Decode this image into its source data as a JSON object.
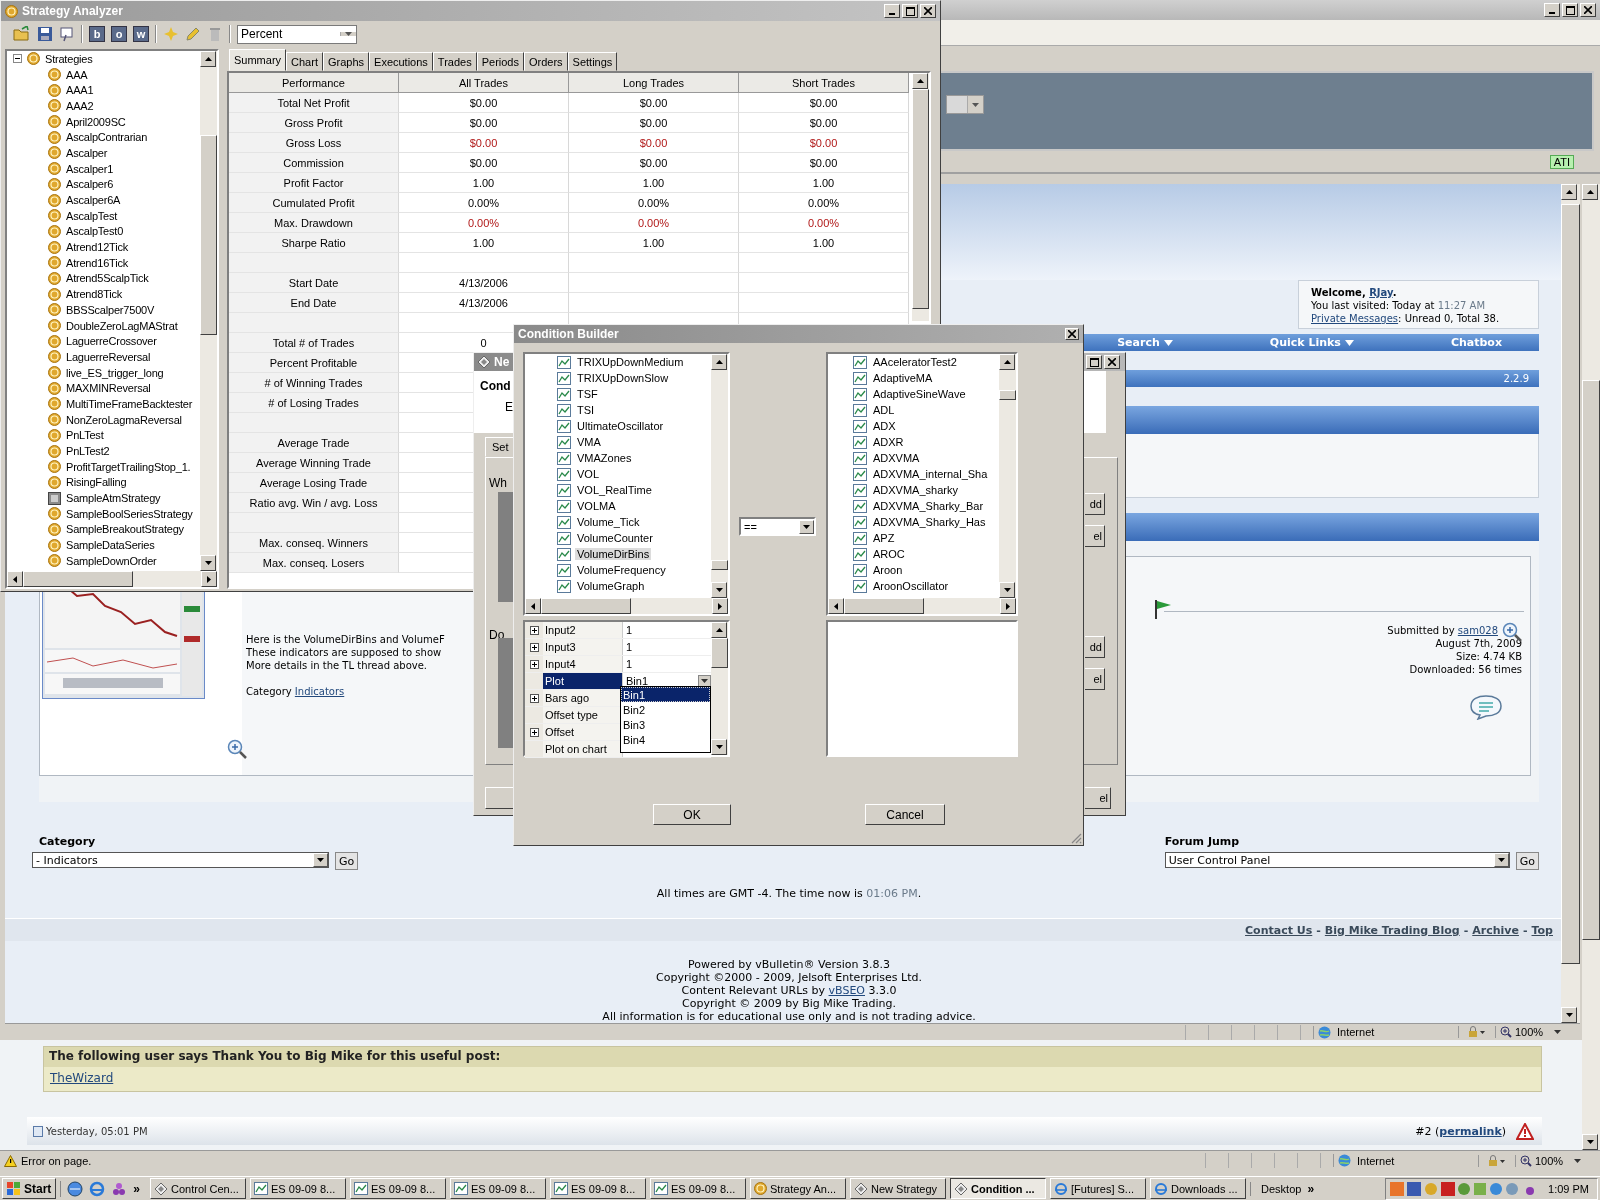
{
  "control_window": {
    "ati_badge": "ATI"
  },
  "strategy_analyzer": {
    "title": "Strategy Analyzer",
    "toolbar_letters": [
      "b",
      "o",
      "w"
    ],
    "dropdown": "Percent",
    "tree": {
      "root": "Strategies",
      "expanded": true,
      "items": [
        {
          "label": "AAA",
          "kind": "coin"
        },
        {
          "label": "AAA1",
          "kind": "coin"
        },
        {
          "label": "AAA2",
          "kind": "coin"
        },
        {
          "label": "April2009SC",
          "kind": "coin"
        },
        {
          "label": "AscalpContrarian",
          "kind": "coin"
        },
        {
          "label": "Ascalper",
          "kind": "coin"
        },
        {
          "label": "Ascalper1",
          "kind": "coin"
        },
        {
          "label": "Ascalper6",
          "kind": "coin"
        },
        {
          "label": "Ascalper6A",
          "kind": "coin"
        },
        {
          "label": "AscalpTest",
          "kind": "coin"
        },
        {
          "label": "AscalpTest0",
          "kind": "coin"
        },
        {
          "label": "Atrend12Tick",
          "kind": "coin"
        },
        {
          "label": "Atrend16Tick",
          "kind": "coin"
        },
        {
          "label": "Atrend5ScalpTick",
          "kind": "coin"
        },
        {
          "label": "Atrend8Tick",
          "kind": "coin"
        },
        {
          "label": "BBSScalper7500V",
          "kind": "coin"
        },
        {
          "label": "DoubleZeroLagMAStrat",
          "kind": "coin"
        },
        {
          "label": "LaguerreCrossover",
          "kind": "coin"
        },
        {
          "label": "LaguerreReversal",
          "kind": "coin"
        },
        {
          "label": "live_ES_trigger_long",
          "kind": "coin"
        },
        {
          "label": "MAXMINReversal",
          "kind": "coin"
        },
        {
          "label": "MultiTimeFrameBacktester",
          "kind": "coin"
        },
        {
          "label": "NonZeroLagmaReversal",
          "kind": "coin"
        },
        {
          "label": "PnLTest",
          "kind": "coin"
        },
        {
          "label": "PnLTest2",
          "kind": "coin"
        },
        {
          "label": "ProfitTargetTrailingStop_1.",
          "kind": "coin"
        },
        {
          "label": "RisingFalling",
          "kind": "coin"
        },
        {
          "label": "SampleAtmStrategy",
          "kind": "atm"
        },
        {
          "label": "SampleBoolSeriesStrategy",
          "kind": "coin"
        },
        {
          "label": "SampleBreakoutStrategy",
          "kind": "coin"
        },
        {
          "label": "SampleDataSeries",
          "kind": "coin"
        },
        {
          "label": "SampleDownOrder",
          "kind": "coin"
        }
      ]
    },
    "tabs": [
      {
        "label": "Summary",
        "selected": true
      },
      {
        "label": "Chart",
        "selected": false
      },
      {
        "label": "Graphs",
        "selected": false
      },
      {
        "label": "Executions",
        "selected": false
      },
      {
        "label": "Trades",
        "selected": false
      },
      {
        "label": "Periods",
        "selected": false
      },
      {
        "label": "Orders",
        "selected": false
      },
      {
        "label": "Settings",
        "selected": false
      }
    ],
    "table": {
      "columns": [
        "Performance",
        "All Trades",
        "Long Trades",
        "Short Trades"
      ],
      "rows": [
        {
          "kind": "data",
          "cells": [
            "Total Net Profit",
            "$0.00",
            "$0.00",
            "$0.00"
          ],
          "negative": false
        },
        {
          "kind": "data",
          "cells": [
            "Gross Profit",
            "$0.00",
            "$0.00",
            "$0.00"
          ],
          "negative": false
        },
        {
          "kind": "data",
          "cells": [
            "Gross Loss",
            "$0.00",
            "$0.00",
            "$0.00"
          ],
          "negative": true
        },
        {
          "kind": "data",
          "cells": [
            "Commission",
            "$0.00",
            "$0.00",
            "$0.00"
          ],
          "negative": false
        },
        {
          "kind": "data",
          "cells": [
            "Profit Factor",
            "1.00",
            "1.00",
            "1.00"
          ],
          "negative": false
        },
        {
          "kind": "data",
          "cells": [
            "Cumulated Profit",
            "0.00%",
            "0.00%",
            "0.00%"
          ],
          "negative": false
        },
        {
          "kind": "data",
          "cells": [
            "Max. Drawdown",
            "0.00%",
            "0.00%",
            "0.00%"
          ],
          "negative": true
        },
        {
          "kind": "data",
          "cells": [
            "Sharpe Ratio",
            "1.00",
            "1.00",
            "1.00"
          ],
          "negative": false
        },
        {
          "kind": "spacer"
        },
        {
          "kind": "data",
          "cells": [
            "Start Date",
            "4/13/2006"
          ],
          "negative": false
        },
        {
          "kind": "data",
          "cells": [
            "End Date",
            "4/13/2006"
          ],
          "negative": false
        },
        {
          "kind": "spacer"
        },
        {
          "kind": "data",
          "cells": [
            "Total # of Trades",
            "0"
          ],
          "negative": false
        },
        {
          "kind": "data",
          "cells": [
            "Percent Profitable"
          ]
        },
        {
          "kind": "data",
          "cells": [
            "# of Winning Trades"
          ]
        },
        {
          "kind": "data",
          "cells": [
            "# of Losing Trades"
          ]
        },
        {
          "kind": "spacer"
        },
        {
          "kind": "data",
          "cells": [
            "Average Trade"
          ]
        },
        {
          "kind": "data",
          "cells": [
            "Average Winning Trade"
          ]
        },
        {
          "kind": "data",
          "cells": [
            "Average Losing Trade"
          ]
        },
        {
          "kind": "data",
          "cells": [
            "Ratio avg. Win / avg. Loss"
          ]
        },
        {
          "kind": "spacer"
        },
        {
          "kind": "data",
          "cells": [
            "Max. conseq. Winners"
          ]
        },
        {
          "kind": "data",
          "cells": [
            "Max. conseq. Losers"
          ]
        }
      ]
    }
  },
  "new_strategy": {
    "title": "Ne",
    "heading": "Cond",
    "line": "E",
    "tab": "Set",
    "label_1": "Wh",
    "label_2": "Do",
    "side_buttons": [
      "dd",
      "el",
      "dd",
      "el",
      "el"
    ]
  },
  "condition_builder": {
    "title": "Condition Builder",
    "left_list": [
      {
        "label": "TRIXUpDownMedium",
        "selected": false
      },
      {
        "label": "TRIXUpDownSlow",
        "selected": false
      },
      {
        "label": "TSF",
        "selected": false
      },
      {
        "label": "TSI",
        "selected": false
      },
      {
        "label": "UltimateOscillator",
        "selected": false
      },
      {
        "label": "VMA",
        "selected": false
      },
      {
        "label": "VMAZones",
        "selected": false
      },
      {
        "label": "VOL",
        "selected": false
      },
      {
        "label": "VOL_RealTime",
        "selected": false
      },
      {
        "label": "VOLMA",
        "selected": false
      },
      {
        "label": "Volume_Tick",
        "selected": false
      },
      {
        "label": "VolumeCounter",
        "selected": false
      },
      {
        "label": "VolumeDirBins",
        "selected": true
      },
      {
        "label": "VolumeFrequency",
        "selected": false
      },
      {
        "label": "VolumeGraph",
        "selected": false
      }
    ],
    "right_list": [
      "AAceleratorTest2",
      "AdaptiveMA",
      "AdaptiveSineWave",
      "ADL",
      "ADX",
      "ADXR",
      "ADXVMA",
      "ADXVMA_internal_Sha",
      "ADXVMA_sharky",
      "ADXVMA_Sharky_Bar",
      "ADXVMA_Sharky_Has",
      "APZ",
      "AROC",
      "Aroon",
      "AroonOscillator"
    ],
    "properties": [
      {
        "name": "Input2",
        "value": "1",
        "expandable": true,
        "selected": false
      },
      {
        "name": "Input3",
        "value": "1",
        "expandable": true,
        "selected": false
      },
      {
        "name": "Input4",
        "value": "1",
        "expandable": true,
        "selected": false
      },
      {
        "name": "Plot",
        "value": "Bin1",
        "expandable": false,
        "selected": true
      },
      {
        "name": "Bars ago",
        "expandable": true,
        "selected": false
      },
      {
        "name": "Offset type",
        "expandable": false,
        "selected": false
      },
      {
        "name": "Offset",
        "expandable": true,
        "selected": false
      },
      {
        "name": "Plot on chart",
        "expandable": false,
        "selected": false
      }
    ],
    "plot_options": [
      {
        "label": "Bin1",
        "selected": true
      },
      {
        "label": "Bin2",
        "selected": false
      },
      {
        "label": "Bin3",
        "selected": false
      },
      {
        "label": "Bin4",
        "selected": false
      }
    ],
    "operator": "==",
    "buttons": [
      "OK",
      "Cancel"
    ]
  },
  "browser": {
    "welcome": {
      "greeting": "Welcome, ",
      "user": "RJay",
      "end": ".",
      "last_visited": "You last visited: Today at ",
      "last_time": "11:27 AM",
      "messages_link": "Private Messages",
      "messages_text": ": Unread 0, Total 38."
    },
    "nav": [
      {
        "label": "Search",
        "dropdown": true
      },
      {
        "label": "Quick Links",
        "dropdown": true
      },
      {
        "label": "Chatbox",
        "dropdown": false
      }
    ],
    "version": "2.2.9",
    "attachment": {
      "lines": [
        "Here is the VolumeDirBins and VolumeF",
        "These indicators are supposed to show",
        "More details in the TL thread above."
      ],
      "category_label": "Category ",
      "category_link": "Indicators",
      "submitted_by": "Submitted by ",
      "submitter": "sam028",
      "date": "August 7th, 2009",
      "size": "Size: 4.74 KB",
      "downloads": "Downloaded: 56 times"
    },
    "category": {
      "label": "Category",
      "value": "- Indicators",
      "go": "Go"
    },
    "forum_jump": {
      "label": "Forum Jump",
      "value": "User Control Panel",
      "go": "Go"
    },
    "times": {
      "text": "All times are GMT -4. The time now is ",
      "time": "01:06 PM",
      "end": "."
    },
    "footer_links": [
      "Contact Us",
      "Big Mike Trading Blog",
      "Archive",
      "Top"
    ],
    "footer_separator": "-",
    "powered": [
      {
        "text": "Powered by vBulletin® Version 3.8.3"
      },
      {
        "text": "Copyright ©2000 - 2009, Jelsoft Enterprises Ltd."
      },
      {
        "text": "Content Relevant URLs by ",
        "link": "vBSEO",
        "after": " 3.3.0"
      },
      {
        "text": "Copyright © 2009 by Big Mike Trading."
      },
      {
        "text": "All information is for educational use only and is not trading advice."
      }
    ],
    "status": {
      "zone": "Internet",
      "zoom": "100%"
    },
    "thanks": {
      "heading": "The following user says Thank You to Big Mike for this useful post:",
      "users": [
        "TheWizard"
      ]
    },
    "post": {
      "date": "Yesterday, 05:01 PM",
      "number": "#2 (",
      "permalink": "permalink",
      "close": ")"
    },
    "outer_status": {
      "message": "Error on page.",
      "zone": "Internet",
      "zoom": "100%"
    }
  },
  "taskbar": {
    "start": "Start",
    "more": "»",
    "tasks": [
      {
        "label": "Control Cen...",
        "kind": "diamond",
        "selected": false
      },
      {
        "label": "ES 09-09  8...",
        "kind": "chart",
        "selected": false
      },
      {
        "label": "ES 09-09  8...",
        "kind": "chart",
        "selected": false
      },
      {
        "label": "ES 09-09  8...",
        "kind": "chart",
        "selected": false
      },
      {
        "label": "ES 09-09  8...",
        "kind": "chart",
        "selected": false
      },
      {
        "label": "ES 09-09  8...",
        "kind": "chart",
        "selected": false
      },
      {
        "label": "Strategy An...",
        "kind": "coin",
        "selected": false
      },
      {
        "label": "New Strategy",
        "kind": "diamond",
        "selected": false
      },
      {
        "label": "Condition ...",
        "kind": "diamond",
        "selected": true
      },
      {
        "label": "[Futures] S...",
        "kind": "browser",
        "selected": false
      },
      {
        "label": "Downloads ...",
        "kind": "browser",
        "selected": false
      }
    ],
    "toolbar": "Desktop",
    "toolbar_more": "»",
    "clock": "1:09 PM"
  }
}
